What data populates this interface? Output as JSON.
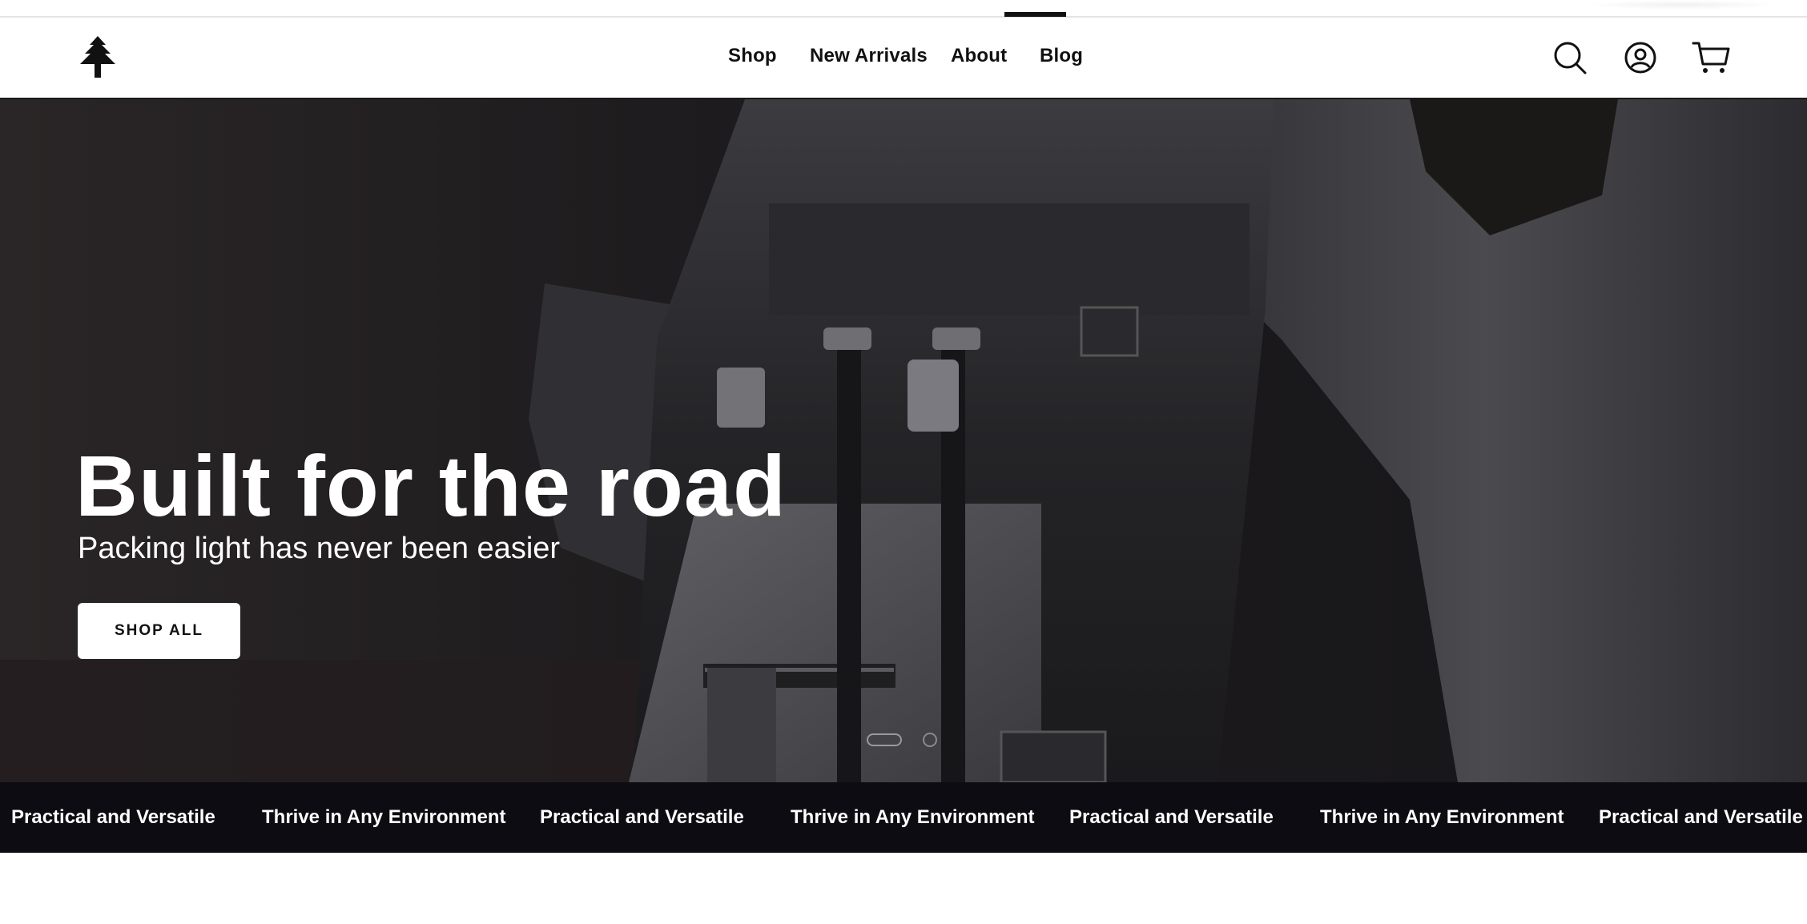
{
  "header": {
    "logo_icon": "pine-tree-icon",
    "nav": [
      {
        "label": "Shop"
      },
      {
        "label": "New Arrivals"
      },
      {
        "label": "About"
      },
      {
        "label": "Blog"
      }
    ],
    "icons": [
      "search-icon",
      "account-icon",
      "cart-icon"
    ]
  },
  "hero": {
    "title": "Built for the road",
    "subtitle": "Packing light has never been easier",
    "button_label": "SHOP ALL",
    "slides_total": 2,
    "active_slide": 1
  },
  "marquee": {
    "items": [
      "Practical and Versatile",
      "Thrive in Any Environment",
      "Practical and Versatile",
      "Thrive in Any Environment",
      "Practical and Versatile",
      "Thrive in Any Environment",
      "Practical and Versatile"
    ]
  },
  "colors": {
    "header_bg": "#ffffff",
    "text": "#111111",
    "hero_bg": "#1b1a1c",
    "marquee_bg": "#0c0c12",
    "button_bg": "#ffffff"
  }
}
